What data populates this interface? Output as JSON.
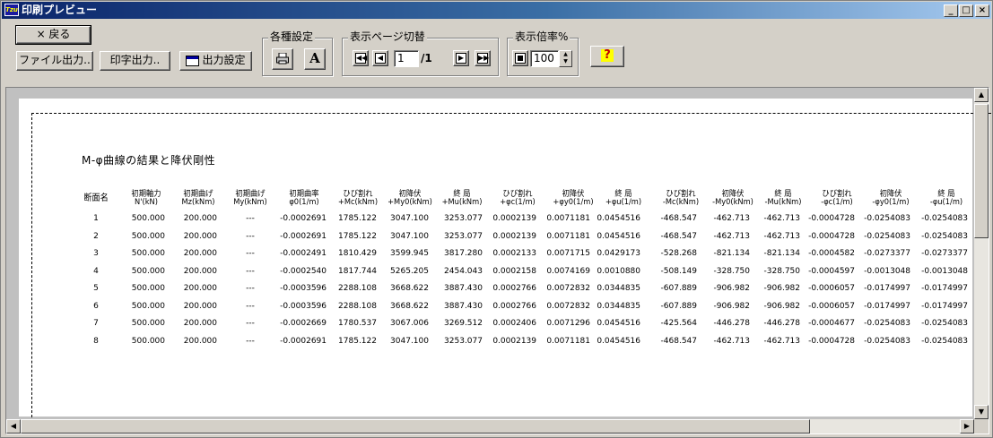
{
  "window": {
    "title": "印刷プレビュー",
    "app_icon_text": "Tzu",
    "controls": [
      "_",
      "□",
      "×"
    ]
  },
  "toolbar": {
    "back_label": "× 戻る",
    "file_output_label": "ファイル出力..",
    "print_output_label": "印字出力..",
    "output_settings_label": "出力設定",
    "group_settings_label": "各種設定",
    "font_button_label": "A",
    "group_page_label": "表示ページ切替",
    "page_current": "1",
    "page_total": "/1",
    "group_zoom_label": "表示倍率%",
    "zoom_value": "100",
    "help_label": "?"
  },
  "report": {
    "heading": "M-φ曲線の結果と降伏剛性",
    "columns": [
      [
        "断面名",
        ""
      ],
      [
        "初期軸力",
        "N'(kN)"
      ],
      [
        "初期曲げ",
        "Mz(kNm)"
      ],
      [
        "初期曲げ",
        "My(kNm)"
      ],
      [
        "初期曲率",
        "φ0(1/m)"
      ],
      [
        "ひび割れ",
        "+Mc(kNm)"
      ],
      [
        "初降伏",
        "+My0(kNm)"
      ],
      [
        "終 局",
        "+Mu(kNm)"
      ],
      [
        "ひび割れ",
        "+φc(1/m)"
      ],
      [
        "初降伏",
        "+φy0(1/m)"
      ],
      [
        "終 局",
        "+φu(1/m)"
      ],
      [
        "ひび割れ",
        "-Mc(kNm)"
      ],
      [
        "初降伏",
        "-My0(kNm)"
      ],
      [
        "終 局",
        "-Mu(kNm)"
      ],
      [
        "ひび割れ",
        "-φc(1/m)"
      ],
      [
        "初降伏",
        "-φy0(1/m)"
      ],
      [
        "終 局",
        "-φu(1/m)"
      ]
    ],
    "rows": [
      [
        "1",
        "500.000",
        "200.000",
        "---",
        "-0.0002691",
        "1785.122",
        "3047.100",
        "3253.077",
        "0.0002139",
        "0.0071181",
        "0.0454516",
        "-468.547",
        "-462.713",
        "-462.713",
        "-0.0004728",
        "-0.0254083",
        "-0.0254083"
      ],
      [
        "2",
        "500.000",
        "200.000",
        "---",
        "-0.0002691",
        "1785.122",
        "3047.100",
        "3253.077",
        "0.0002139",
        "0.0071181",
        "0.0454516",
        "-468.547",
        "-462.713",
        "-462.713",
        "-0.0004728",
        "-0.0254083",
        "-0.0254083"
      ],
      [
        "3",
        "500.000",
        "200.000",
        "---",
        "-0.0002491",
        "1810.429",
        "3599.945",
        "3817.280",
        "0.0002133",
        "0.0071715",
        "0.0429173",
        "-528.268",
        "-821.134",
        "-821.134",
        "-0.0004582",
        "-0.0273377",
        "-0.0273377"
      ],
      [
        "4",
        "500.000",
        "200.000",
        "---",
        "-0.0002540",
        "1817.744",
        "5265.205",
        "2454.043",
        "0.0002158",
        "0.0074169",
        "0.0010880",
        "-508.149",
        "-328.750",
        "-328.750",
        "-0.0004597",
        "-0.0013048",
        "-0.0013048"
      ],
      [
        "5",
        "500.000",
        "200.000",
        "---",
        "-0.0003596",
        "2288.108",
        "3668.622",
        "3887.430",
        "0.0002766",
        "0.0072832",
        "0.0344835",
        "-607.889",
        "-906.982",
        "-906.982",
        "-0.0006057",
        "-0.0174997",
        "-0.0174997"
      ],
      [
        "6",
        "500.000",
        "200.000",
        "---",
        "-0.0003596",
        "2288.108",
        "3668.622",
        "3887.430",
        "0.0002766",
        "0.0072832",
        "0.0344835",
        "-607.889",
        "-906.982",
        "-906.982",
        "-0.0006057",
        "-0.0174997",
        "-0.0174997"
      ],
      [
        "7",
        "500.000",
        "200.000",
        "---",
        "-0.0002669",
        "1780.537",
        "3067.006",
        "3269.512",
        "0.0002406",
        "0.0071296",
        "0.0454516",
        "-425.564",
        "-446.278",
        "-446.278",
        "-0.0004677",
        "-0.0254083",
        "-0.0254083"
      ],
      [
        "8",
        "500.000",
        "200.000",
        "---",
        "-0.0002691",
        "1785.122",
        "3047.100",
        "3253.077",
        "0.0002139",
        "0.0071181",
        "0.0454516",
        "-468.547",
        "-462.713",
        "-462.713",
        "-0.0004728",
        "-0.0254083",
        "-0.0254083"
      ]
    ]
  }
}
